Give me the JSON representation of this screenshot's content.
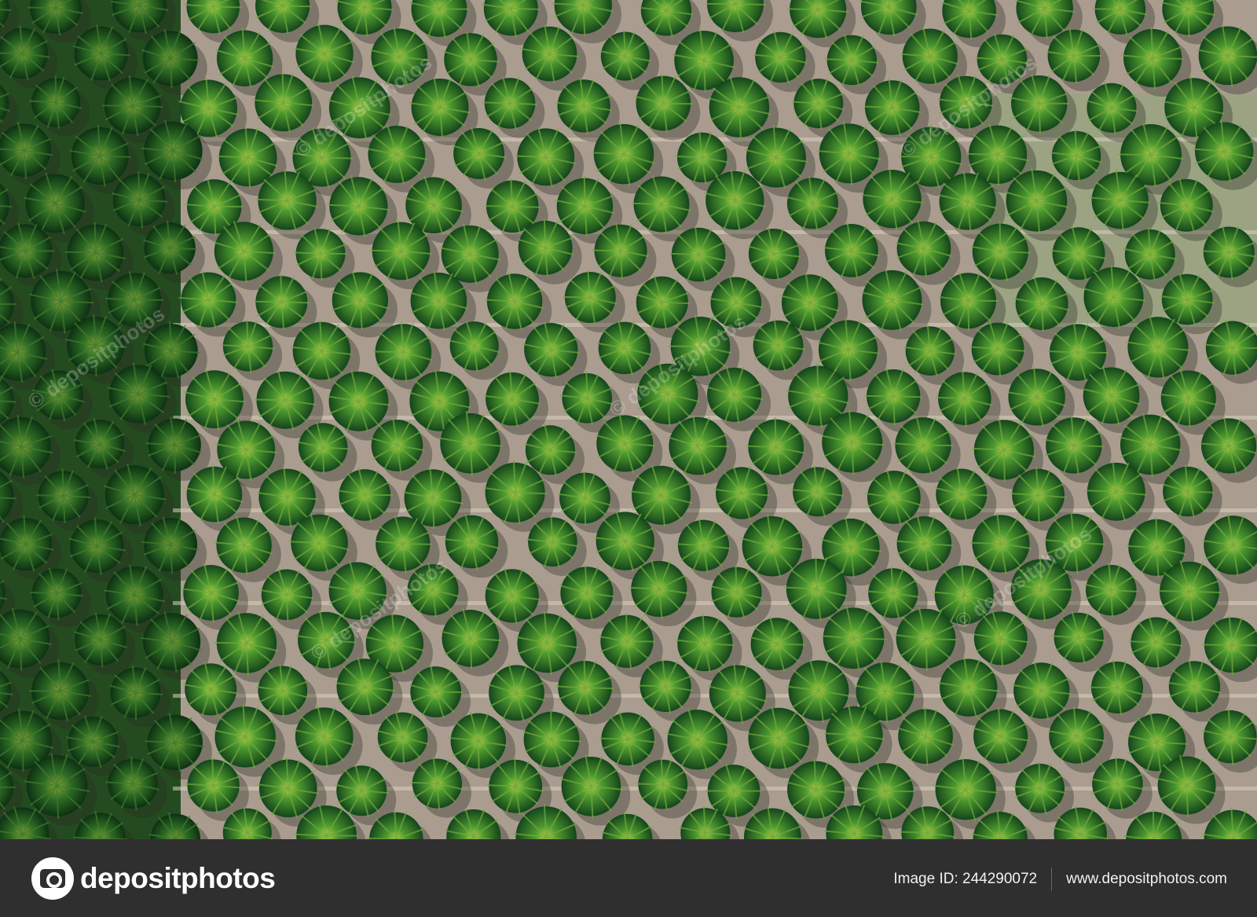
{
  "photo": {
    "description_icon": "aerial-palm-plantation",
    "watermark_text": "© depositphotos"
  },
  "footer": {
    "brand": "depositphotos",
    "image_id": "Image ID: 244290072",
    "site": "www.depositphotos.com"
  },
  "colors": {
    "footer_bg": "#2f2f2f",
    "footer_text": "#ffffff",
    "soil": "#b2a698",
    "canopy_dark": "#1f4d1f",
    "canopy_light": "#3f8f35"
  }
}
